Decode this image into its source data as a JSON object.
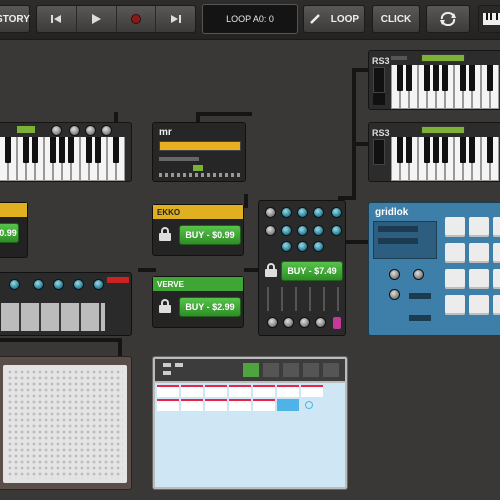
{
  "toolbar": {
    "history_label": "STORY",
    "lcd_text": "LOOP A0: 0",
    "loop_label": "LOOP",
    "click_label": "CLICK"
  },
  "devices": {
    "rs3_top": {
      "name": "RS3"
    },
    "rs3_mid": {
      "name": "RS3"
    },
    "mr": {
      "name": "mr"
    },
    "ekko": {
      "name": "EKKO",
      "buy": "BUY - $0.99"
    },
    "verve": {
      "name": "VERVE",
      "buy": "BUY - $2.99"
    },
    "mixer": {
      "buy": "BUY - $7.49"
    },
    "gridlok": {
      "name": "gridlok"
    },
    "left_unit": {
      "buy": "0.99"
    }
  },
  "colors": {
    "buy_green": "#3fa535",
    "accent_yellow": "#e0b020",
    "gridlok_blue": "#3d7fa8"
  }
}
